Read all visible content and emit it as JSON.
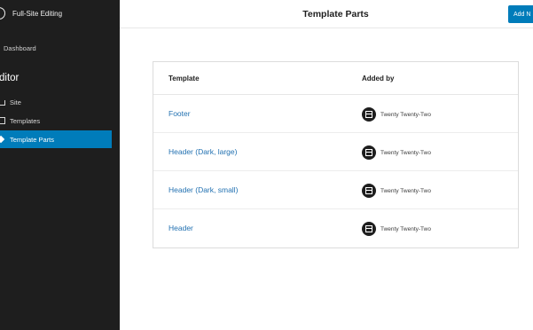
{
  "sidebar": {
    "site_title": "Full-Site Editing",
    "dashboard_label": "Dashboard",
    "section_heading": "ditor",
    "items": [
      {
        "label": "Site",
        "icon": "home-icon"
      },
      {
        "label": "Templates",
        "icon": "layout-icon"
      },
      {
        "label": "Template Parts",
        "icon": "symbol-icon",
        "active": true
      }
    ]
  },
  "header": {
    "title": "Template Parts",
    "add_new_label": "Add N"
  },
  "table": {
    "columns": [
      "Template",
      "Added by"
    ],
    "rows": [
      {
        "template": "Footer",
        "added_by": "Twenty Twenty-Two"
      },
      {
        "template": "Header (Dark, large)",
        "added_by": "Twenty Twenty-Two"
      },
      {
        "template": "Header (Dark, small)",
        "added_by": "Twenty Twenty-Two"
      },
      {
        "template": "Header",
        "added_by": "Twenty Twenty-Two"
      }
    ]
  },
  "colors": {
    "sidebar_bg": "#1e1e1e",
    "accent": "#007cba",
    "link": "#2271b1"
  }
}
